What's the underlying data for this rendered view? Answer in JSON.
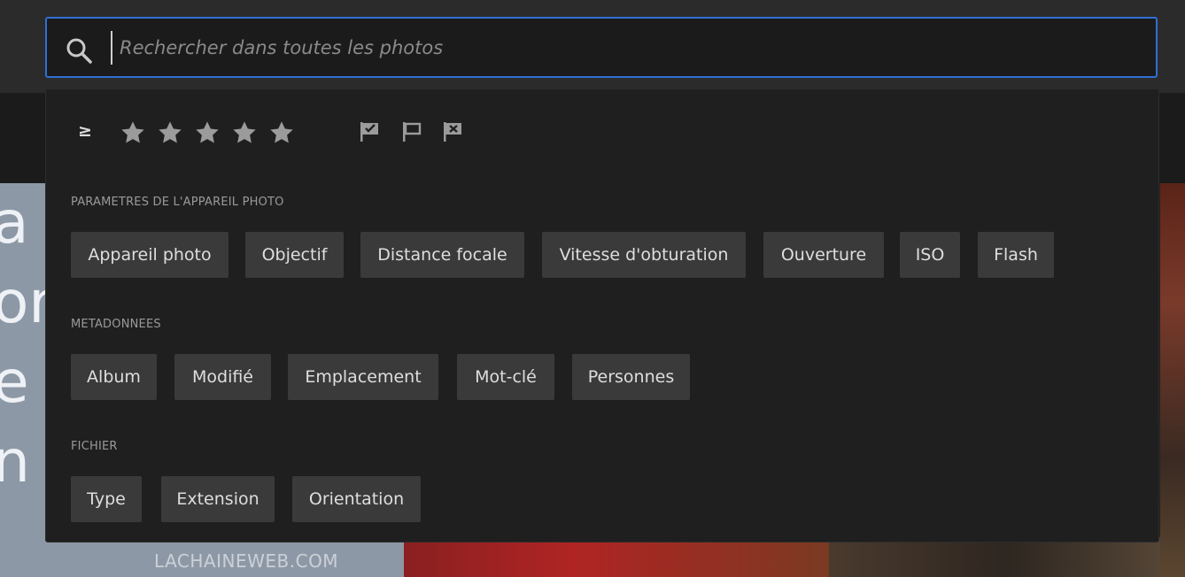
{
  "search": {
    "placeholder": "Rechercher dans toutes les photos",
    "value": ""
  },
  "filters": {
    "rating_operator": "≥",
    "stars": [
      {
        "icon": "star-icon"
      },
      {
        "icon": "star-icon"
      },
      {
        "icon": "star-icon"
      },
      {
        "icon": "star-icon"
      },
      {
        "icon": "star-icon"
      }
    ],
    "flags": [
      {
        "icon": "flag-picked-icon"
      },
      {
        "icon": "flag-unflagged-icon"
      },
      {
        "icon": "flag-rejected-icon"
      }
    ]
  },
  "sections": {
    "camera": {
      "label": "PARAMETRES DE L'APPAREIL PHOTO",
      "chips": [
        "Appareil photo",
        "Objectif",
        "Distance focale",
        "Vitesse d'obturation",
        "Ouverture",
        "ISO",
        "Flash"
      ]
    },
    "metadata": {
      "label": "METADONNEES",
      "chips": [
        "Album",
        "Modifié",
        "Emplacement",
        "Mot-clé",
        "Personnes"
      ]
    },
    "file": {
      "label": "FICHIER",
      "chips": [
        "Type",
        "Extension",
        "Orientation"
      ]
    }
  },
  "background": {
    "left_text": [
      "a",
      "or",
      "e",
      "n"
    ],
    "watermark": "LACHAINEWEB.COM"
  },
  "colors": {
    "accent": "#2f6fd6",
    "panel": "#1f1f1f",
    "chip": "#3a3a3a",
    "icon": "#9b9b9b"
  }
}
